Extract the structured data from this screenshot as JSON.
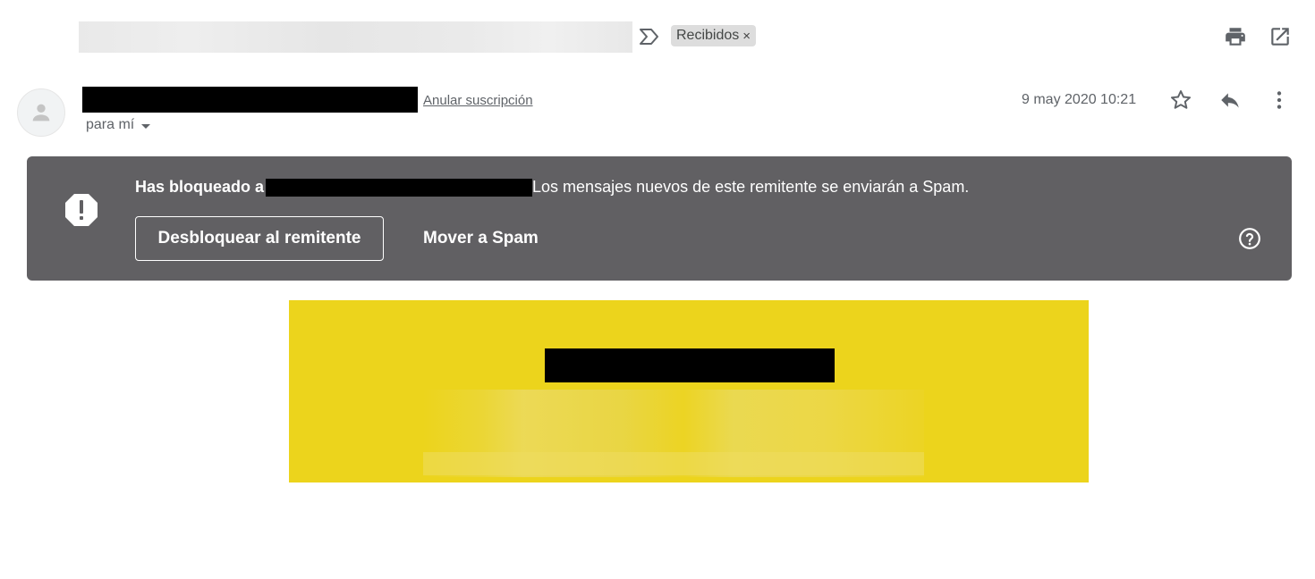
{
  "thread": {
    "label_chip": "Recibidos",
    "label_remove": "×"
  },
  "message": {
    "unsubscribe": "Anular suscripción",
    "recipient": "para mí",
    "date": "9 may 2020 10:21"
  },
  "banner": {
    "prefix": "Has bloqueado a",
    "suffix": "Los mensajes nuevos de este remitente se enviarán a Spam.",
    "unblock_button": "Desbloquear al remitente",
    "spam_button": "Mover a Spam"
  },
  "icons": {
    "importance": "importance-marker-icon",
    "print": "print-icon",
    "open_new_window": "open-in-new-window-icon",
    "avatar": "person-avatar-icon",
    "star": "star-icon",
    "reply": "reply-icon",
    "more": "more-vertical-icon",
    "alert": "alert-octagon-icon",
    "help": "help-circle-icon"
  },
  "colors": {
    "banner_bg": "#616063",
    "hero_bg": "#ecd41c",
    "chip_bg": "#dddddd"
  }
}
